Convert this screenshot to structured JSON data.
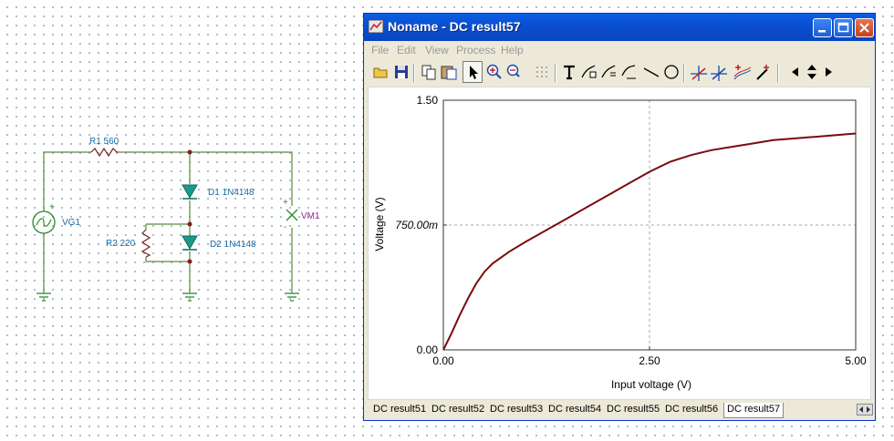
{
  "schematic": {
    "r1_label": "R1 560",
    "d1_label": "D1 1N4148",
    "r2_label": "R2 220",
    "d2_label": "D2 1N4148",
    "vg1_label": "VG1",
    "vm1_label": "VM1",
    "plus": "+",
    "minus": "-"
  },
  "window": {
    "title": "Noname - DC result57",
    "menu": [
      "File",
      "Edit",
      "View",
      "Process",
      "Help"
    ],
    "toolbar_icons": [
      "open-icon",
      "save-icon",
      "copy-icon",
      "paste-icon",
      "pointer-icon",
      "zoom-in-icon",
      "zoom-100-icon",
      "grid-icon",
      "text-icon",
      "label-curve-icon",
      "label-curve-2-icon",
      "label-curve-3-icon",
      "line-icon",
      "circle-icon",
      "cursor-a-icon",
      "cursor-b-icon",
      "add-curve-icon",
      "edit-curve-icon",
      "scroll-left-icon",
      "scroll-vertical-icon",
      "scroll-right-icon"
    ],
    "tabs": [
      "DC result51",
      "DC result52",
      "DC result53",
      "DC result54",
      "DC result55",
      "DC result56",
      "DC result57"
    ],
    "active_tab": "DC result57"
  },
  "colors": {
    "wire": "#5a8a3a",
    "component": "#2f8a2f",
    "diode_fill": "#1a9a8a",
    "label": "#1a6aa0",
    "vm_label": "#8a2a8a",
    "curve": "#7a0a10",
    "title_bar": "#0b4fd0"
  },
  "chart_data": {
    "type": "line",
    "xlabel": "Input voltage (V)",
    "ylabel": "Voltage (V)",
    "x_ticks": [
      "0.00",
      "2.50",
      "5.00"
    ],
    "y_ticks": [
      "0.00",
      "750.00m",
      "1.50"
    ],
    "xlim": [
      0,
      5
    ],
    "ylim": [
      0,
      1.5
    ],
    "grid": "dashed at midpoints",
    "series": [
      {
        "x": [
          0,
          0.1,
          0.2,
          0.3,
          0.4,
          0.5,
          0.6,
          0.8,
          1.0,
          1.25,
          1.5,
          1.75,
          2.0,
          2.25,
          2.5,
          2.75,
          3.0,
          3.25,
          3.5,
          3.75,
          4.0,
          4.25,
          4.5,
          4.75,
          5.0
        ],
        "y": [
          0,
          0.1,
          0.21,
          0.31,
          0.4,
          0.47,
          0.52,
          0.59,
          0.65,
          0.72,
          0.79,
          0.86,
          0.93,
          1.0,
          1.07,
          1.13,
          1.17,
          1.2,
          1.22,
          1.24,
          1.26,
          1.27,
          1.28,
          1.29,
          1.3
        ]
      }
    ]
  }
}
